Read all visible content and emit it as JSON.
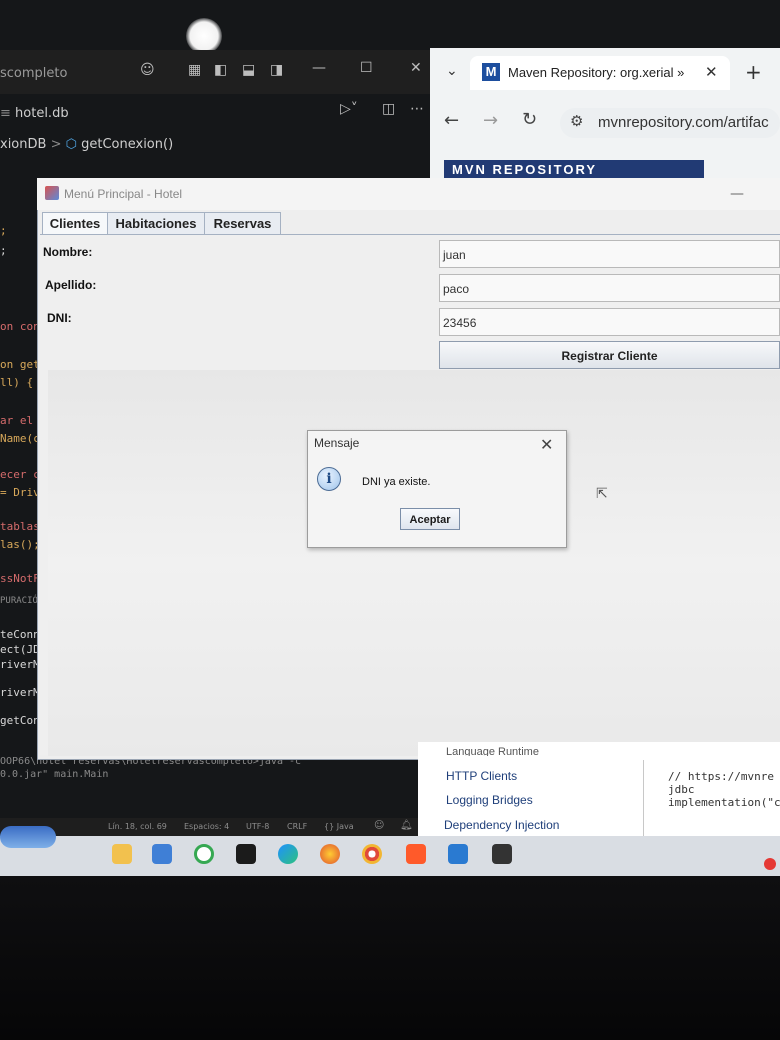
{
  "vscode": {
    "title_fragment": "scompleto",
    "file_tab": "hotel.db",
    "breadcrumb_fragment": "xionDB",
    "breadcrumb_method": "getConexion()",
    "code_lines": [
      ";",
      ";",
      "on conex",
      "on getCo",
      "ll) {",
      "ar el dr",
      "Name(clas",
      "ecer con",
      "= Driverm",
      "tablas si",
      "las();",
      "ssNotFound",
      "PURACIÓN",
      "teConnectior",
      "ect(JDBC.jav",
      "riverManager.",
      "riverManager.",
      "getConexion(Co"
    ],
    "terminal_line1": "OOP66\\hotel reservas\\Hotelreservascompleto>java -c",
    "terminal_line2": "0.0.jar\" main.Main",
    "status_items": [
      "Lín. 18, col. 69",
      "Espacios: 4",
      "UTF-8",
      "CRLF",
      "{} Java"
    ]
  },
  "browser": {
    "tab_title": "Maven Repository: org.xerial »",
    "url": "mvnrepository.com/artifac",
    "banner_fragment": "MVN REPOSITORY",
    "sidebar_links": [
      "Language Runtime",
      "HTTP Clients",
      "Logging Bridges",
      "Dependency Injection"
    ],
    "snippet_lines": [
      "// https://mvnre",
      "jdbc",
      "implementation(\"c"
    ]
  },
  "app": {
    "window_title": "Menú Principal - Hotel",
    "tabs": [
      "Clientes",
      "Habitaciones",
      "Reservas"
    ],
    "labels": {
      "nombre": "Nombre:",
      "apellido": "Apellido:",
      "dni": "DNI:"
    },
    "values": {
      "nombre": "juan",
      "apellido": "paco",
      "dni": "23456"
    },
    "register_button": "Registrar Cliente"
  },
  "dialog": {
    "title": "Mensaje",
    "message": "DNI ya existe.",
    "ok_button": "Aceptar",
    "icon": "info-icon"
  }
}
